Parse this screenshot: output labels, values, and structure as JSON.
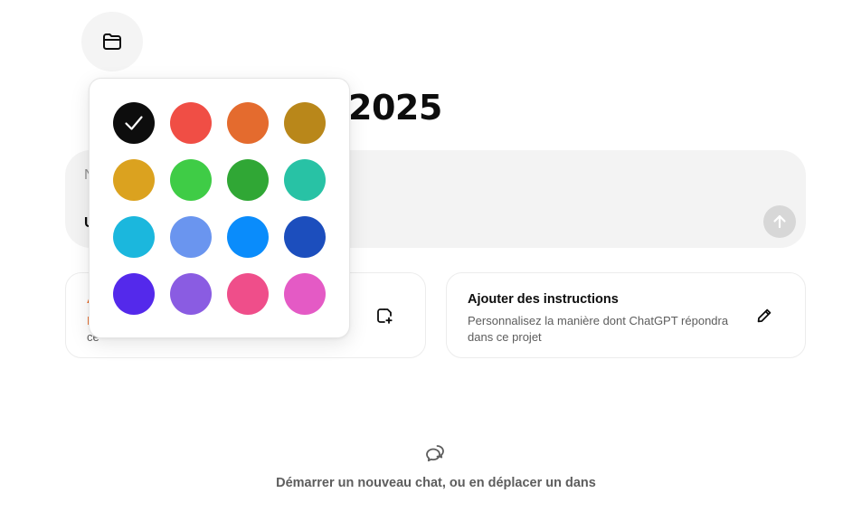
{
  "header": {
    "folder_icon": "folder-icon",
    "title": "2025"
  },
  "composer": {
    "placeholder": "N",
    "tool_label": "U",
    "send_icon": "arrow-up-icon"
  },
  "cards": {
    "files": {
      "title": "A",
      "desc_line1": "I",
      "desc_line2": "ce",
      "icon": "add-file-icon"
    },
    "instructions": {
      "title": "Ajouter des instructions",
      "desc": "Personnalisez la manière dont ChatGPT répondra dans ce projet",
      "icon": "pencil-icon"
    }
  },
  "empty_state": {
    "icon": "chat-bubbles-icon",
    "text": "Démarrer un nouveau chat, ou en déplacer un dans"
  },
  "color_picker": {
    "selected": "#0d0d0d",
    "check_icon": "check-icon",
    "colors": [
      "#0d0d0d",
      "#f04e45",
      "#e46b2e",
      "#b9871a",
      "#dba21f",
      "#3fcc46",
      "#30a735",
      "#28c2a5",
      "#1bb7dd",
      "#6a95ef",
      "#0a8cfb",
      "#1c4ebd",
      "#5429eb",
      "#8a5ce2",
      "#ef4e8a",
      "#e45ac5"
    ]
  }
}
